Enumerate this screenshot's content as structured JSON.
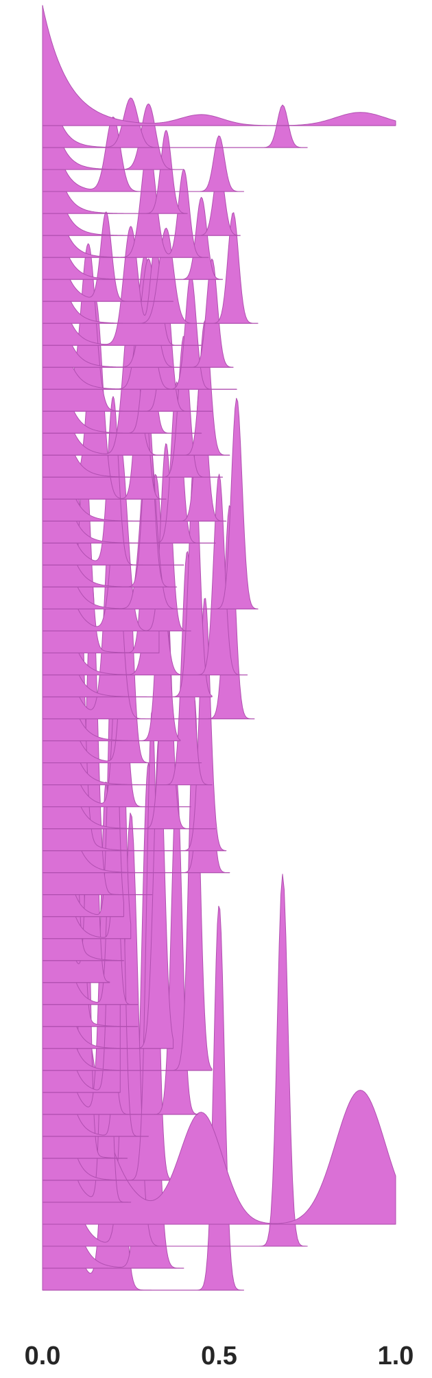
{
  "chart_data": {
    "type": "area",
    "style": "ridgeline",
    "title": "",
    "xlabel": "",
    "ylabel": "",
    "xlim": [
      0.0,
      1.0
    ],
    "grid": false,
    "legend": "none",
    "fill_color": "#da70d6",
    "x_ticks": [
      {
        "value": 0.0,
        "label": "0.0"
      },
      {
        "value": 0.5,
        "label": "0.5"
      },
      {
        "value": 1.0,
        "label": "1.0"
      }
    ],
    "ridge_count": 54,
    "ridges": [
      {
        "x_min": 0.0,
        "x_max": 1.0,
        "decay": 0.072,
        "bumps": [
          [
            0.45,
            0.09,
            0.06
          ],
          [
            0.9,
            0.11,
            0.07
          ]
        ]
      },
      {
        "x_min": 0.0,
        "x_max": 0.75,
        "decay": 0.03,
        "bumps": [
          [
            0.25,
            0.35,
            0.02
          ],
          [
            0.68,
            0.3,
            0.015
          ]
        ]
      },
      {
        "x_min": 0.0,
        "x_max": 0.4,
        "decay": 0.03,
        "bumps": [
          [
            0.3,
            0.4,
            0.02
          ]
        ]
      },
      {
        "x_min": 0.0,
        "x_max": 0.57,
        "decay": 0.03,
        "bumps": [
          [
            0.2,
            0.4,
            0.02
          ],
          [
            0.5,
            0.3,
            0.015
          ]
        ]
      },
      {
        "x_min": 0.0,
        "x_max": 0.41,
        "decay": 0.03,
        "bumps": [
          [
            0.35,
            0.4,
            0.015
          ]
        ]
      },
      {
        "x_min": 0.0,
        "x_max": 0.56,
        "decay": 0.03,
        "bumps": [
          [
            0.5,
            0.3,
            0.015
          ]
        ]
      },
      {
        "x_min": 0.0,
        "x_max": 0.47,
        "decay": 0.03,
        "bumps": [
          [
            0.3,
            0.45,
            0.02
          ],
          [
            0.4,
            0.35,
            0.015
          ]
        ]
      },
      {
        "x_min": 0.0,
        "x_max": 0.51,
        "decay": 0.03,
        "bumps": [
          [
            0.45,
            0.3,
            0.015
          ]
        ]
      },
      {
        "x_min": 0.0,
        "x_max": 0.37,
        "decay": 0.03,
        "bumps": [
          [
            0.18,
            0.3,
            0.015
          ]
        ]
      },
      {
        "x_min": 0.0,
        "x_max": 0.61,
        "decay": 0.03,
        "bumps": [
          [
            0.35,
            0.3,
            0.02
          ],
          [
            0.54,
            0.35,
            0.015
          ]
        ]
      },
      {
        "x_min": 0.0,
        "x_max": 0.45,
        "decay": 0.03,
        "bumps": [
          [
            0.25,
            0.35,
            0.02
          ],
          [
            0.32,
            0.3,
            0.015
          ]
        ]
      },
      {
        "x_min": 0.0,
        "x_max": 0.54,
        "decay": 0.03,
        "bumps": [
          [
            0.3,
            0.3,
            0.02
          ],
          [
            0.48,
            0.3,
            0.015
          ]
        ]
      },
      {
        "x_min": 0.0,
        "x_max": 0.55,
        "decay": 0.03,
        "bumps": [
          [
            0.29,
            0.35,
            0.02
          ],
          [
            0.42,
            0.3,
            0.015
          ]
        ]
      },
      {
        "x_min": 0.0,
        "x_max": 0.48,
        "decay": 0.03,
        "bumps": [
          [
            0.13,
            0.4,
            0.02
          ],
          [
            0.35,
            0.3,
            0.015
          ]
        ]
      },
      {
        "x_min": 0.0,
        "x_max": 0.45,
        "decay": 0.03,
        "bumps": [
          [
            0.3,
            0.3,
            0.015
          ]
        ]
      },
      {
        "x_min": 0.0,
        "x_max": 0.53,
        "decay": 0.03,
        "bumps": [
          [
            0.25,
            0.35,
            0.02
          ],
          [
            0.46,
            0.3,
            0.015
          ]
        ]
      },
      {
        "x_min": 0.0,
        "x_max": 0.51,
        "decay": 0.03,
        "bumps": [
          [
            0.4,
            0.3,
            0.015
          ]
        ]
      },
      {
        "x_min": 0.0,
        "x_max": 0.35,
        "decay": 0.03,
        "bumps": [
          [
            0.15,
            0.4,
            0.02
          ],
          [
            0.28,
            0.35,
            0.015
          ]
        ]
      },
      {
        "x_min": 0.0,
        "x_max": 0.52,
        "decay": 0.03,
        "bumps": [
          [
            0.45,
            0.3,
            0.015
          ]
        ]
      },
      {
        "x_min": 0.0,
        "x_max": 0.49,
        "decay": 0.03,
        "bumps": [
          [
            0.38,
            0.3,
            0.015
          ]
        ]
      },
      {
        "x_min": 0.0,
        "x_max": 0.4,
        "decay": 0.03,
        "bumps": [
          [
            0.2,
            0.3,
            0.015
          ]
        ]
      },
      {
        "x_min": 0.0,
        "x_max": 0.38,
        "decay": 0.03,
        "bumps": [
          [
            0.3,
            0.3,
            0.015
          ]
        ]
      },
      {
        "x_min": 0.0,
        "x_max": 0.61,
        "decay": 0.03,
        "bumps": [
          [
            0.3,
            0.3,
            0.02
          ],
          [
            0.55,
            0.35,
            0.015
          ]
        ]
      },
      {
        "x_min": 0.0,
        "x_max": 0.42,
        "decay": 0.03,
        "bumps": [
          [
            0.22,
            0.3,
            0.02
          ],
          [
            0.35,
            0.3,
            0.015
          ]
        ]
      },
      {
        "x_min": 0.0,
        "x_max": 0.33,
        "decay": 0.03,
        "bumps": [
          [
            0.12,
            0.3,
            0.015
          ],
          [
            0.3,
            0.3,
            0.015
          ]
        ]
      },
      {
        "x_min": 0.0,
        "x_max": 0.58,
        "decay": 0.03,
        "bumps": [
          [
            0.32,
            0.3,
            0.02
          ],
          [
            0.5,
            0.3,
            0.015
          ]
        ]
      },
      {
        "x_min": 0.0,
        "x_max": 0.48,
        "decay": 0.03,
        "bumps": [
          [
            0.43,
            0.35,
            0.015
          ]
        ]
      },
      {
        "x_min": 0.0,
        "x_max": 0.6,
        "decay": 0.03,
        "bumps": [
          [
            0.2,
            0.35,
            0.02
          ],
          [
            0.53,
            0.3,
            0.015
          ]
        ]
      },
      {
        "x_min": 0.0,
        "x_max": 0.39,
        "decay": 0.03,
        "bumps": [
          [
            0.34,
            0.3,
            0.015
          ]
        ]
      },
      {
        "x_min": 0.0,
        "x_max": 0.45,
        "decay": 0.03,
        "bumps": [
          [
            0.24,
            0.3,
            0.015
          ]
        ]
      },
      {
        "x_min": 0.0,
        "x_max": 0.48,
        "decay": 0.03,
        "bumps": [
          [
            0.41,
            0.3,
            0.015
          ]
        ]
      },
      {
        "x_min": 0.0,
        "x_max": 0.42,
        "decay": 0.03,
        "bumps": [
          [
            0.22,
            0.3,
            0.015
          ]
        ]
      },
      {
        "x_min": 0.0,
        "x_max": 0.49,
        "decay": 0.03,
        "bumps": [
          [
            0.35,
            0.3,
            0.015
          ]
        ]
      },
      {
        "x_min": 0.0,
        "x_max": 0.52,
        "decay": 0.03,
        "bumps": [
          [
            0.1,
            0.4,
            0.015
          ],
          [
            0.46,
            0.3,
            0.015
          ]
        ]
      },
      {
        "x_min": 0.0,
        "x_max": 0.53,
        "decay": 0.03,
        "bumps": [
          [
            0.46,
            0.3,
            0.015
          ]
        ]
      },
      {
        "x_min": 0.0,
        "x_max": 0.31,
        "decay": 0.025,
        "bumps": [
          [
            0.14,
            0.35,
            0.015
          ]
        ]
      },
      {
        "x_min": 0.0,
        "x_max": 0.23,
        "decay": 0.025,
        "bumps": [
          [
            0.2,
            0.35,
            0.012
          ]
        ]
      },
      {
        "x_min": 0.0,
        "x_max": 0.25,
        "decay": 0.025,
        "bumps": [
          [
            0.22,
            0.35,
            0.012
          ]
        ]
      },
      {
        "x_min": 0.0,
        "x_max": 0.23,
        "decay": 0.025,
        "bumps": [
          [
            0.08,
            0.4,
            0.012
          ]
        ]
      },
      {
        "x_min": 0.0,
        "x_max": 0.19,
        "decay": 0.025,
        "bumps": [
          [
            0.14,
            0.35,
            0.012
          ]
        ]
      },
      {
        "x_min": 0.0,
        "x_max": 0.27,
        "decay": 0.025,
        "bumps": [
          [
            0.2,
            0.3,
            0.012
          ]
        ]
      },
      {
        "x_min": 0.0,
        "x_max": 0.27,
        "decay": 0.025,
        "bumps": [
          [
            0.1,
            0.4,
            0.012
          ]
        ]
      },
      {
        "x_min": 0.0,
        "x_max": 0.37,
        "decay": 0.025,
        "bumps": [
          [
            0.33,
            0.3,
            0.015
          ]
        ]
      },
      {
        "x_min": 0.0,
        "x_max": 0.48,
        "decay": 0.025,
        "bumps": [
          [
            0.43,
            0.35,
            0.015
          ]
        ]
      },
      {
        "x_min": 0.0,
        "x_max": 0.22,
        "decay": 0.025,
        "bumps": [
          [
            0.2,
            0.35,
            0.012
          ]
        ]
      },
      {
        "x_min": 0.0,
        "x_max": 0.44,
        "decay": 0.025,
        "bumps": [
          [
            0.18,
            0.3,
            0.015
          ],
          [
            0.38,
            0.3,
            0.015
          ]
        ]
      },
      {
        "x_min": 0.0,
        "x_max": 0.3,
        "decay": 0.025,
        "bumps": [
          [
            0.22,
            0.3,
            0.012
          ]
        ]
      },
      {
        "x_min": 0.0,
        "x_max": 0.24,
        "decay": 0.025,
        "bumps": [
          [
            0.12,
            0.35,
            0.012
          ]
        ]
      },
      {
        "x_min": 0.0,
        "x_max": 0.36,
        "decay": 0.025,
        "bumps": [
          [
            0.31,
            0.4,
            0.015
          ]
        ]
      },
      {
        "x_min": 0.0,
        "x_max": 0.25,
        "decay": 0.025,
        "bumps": [
          [
            0.18,
            0.3,
            0.012
          ]
        ]
      }
    ]
  }
}
